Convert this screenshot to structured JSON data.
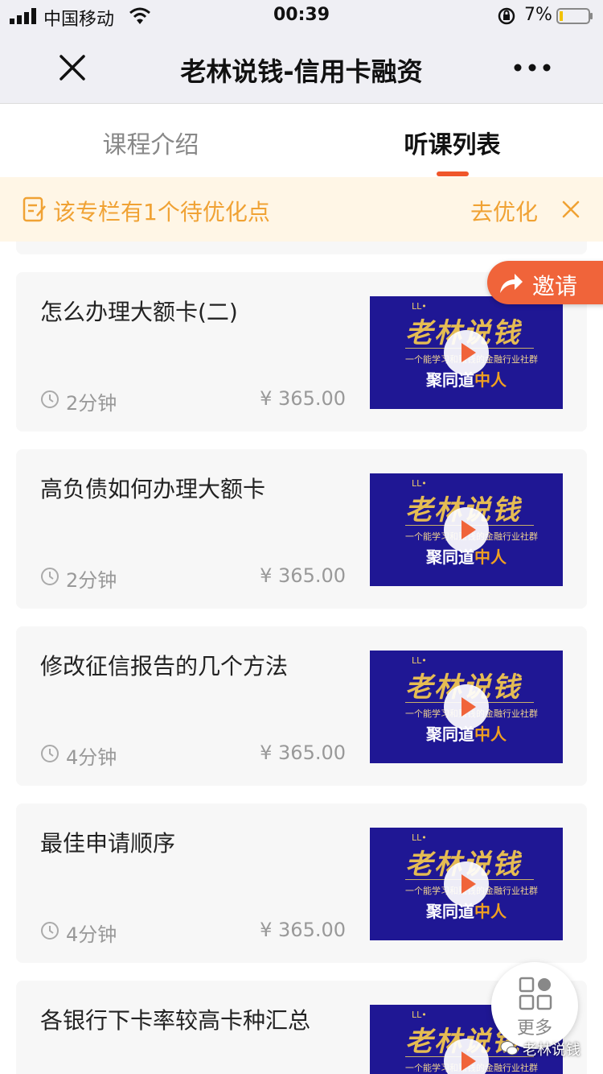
{
  "status_bar": {
    "carrier": "中国移动",
    "time": "00:39",
    "battery_percent": "7%"
  },
  "nav": {
    "title": "老林说钱-信用卡融资"
  },
  "tabs": [
    {
      "label": "课程介绍",
      "active": false
    },
    {
      "label": "听课列表",
      "active": true
    }
  ],
  "notice": {
    "text": "该专栏有1个待优化点",
    "action": "去优化"
  },
  "invite": {
    "label": "邀请"
  },
  "lessons": [
    {
      "title": "怎么办理大额卡(二)",
      "duration": "2分钟",
      "price": "¥  365.00"
    },
    {
      "title": "高负债如何办理大额卡",
      "duration": "2分钟",
      "price": "¥  365.00"
    },
    {
      "title": "修改征信报告的几个方法",
      "duration": "4分钟",
      "price": "¥  365.00"
    },
    {
      "title": "最佳申请顺序",
      "duration": "4分钟",
      "price": "¥  365.00"
    },
    {
      "title": "各银行下卡率较高卡种汇总",
      "duration": "",
      "price": ""
    }
  ],
  "thumbnail": {
    "ll": "LL•",
    "brand": "老林说钱",
    "tagline": "一个能学习和赚钱的金融行业社群",
    "slogan_white": "聚同道",
    "slogan_orange": "中人"
  },
  "more": {
    "label": "更多"
  },
  "watermark": {
    "text": "老林说钱"
  },
  "colors": {
    "accent": "#f0562a",
    "notice_text": "#f0a234",
    "thumb_bg": "#1f1794",
    "invite_bg": "#f0643a"
  }
}
